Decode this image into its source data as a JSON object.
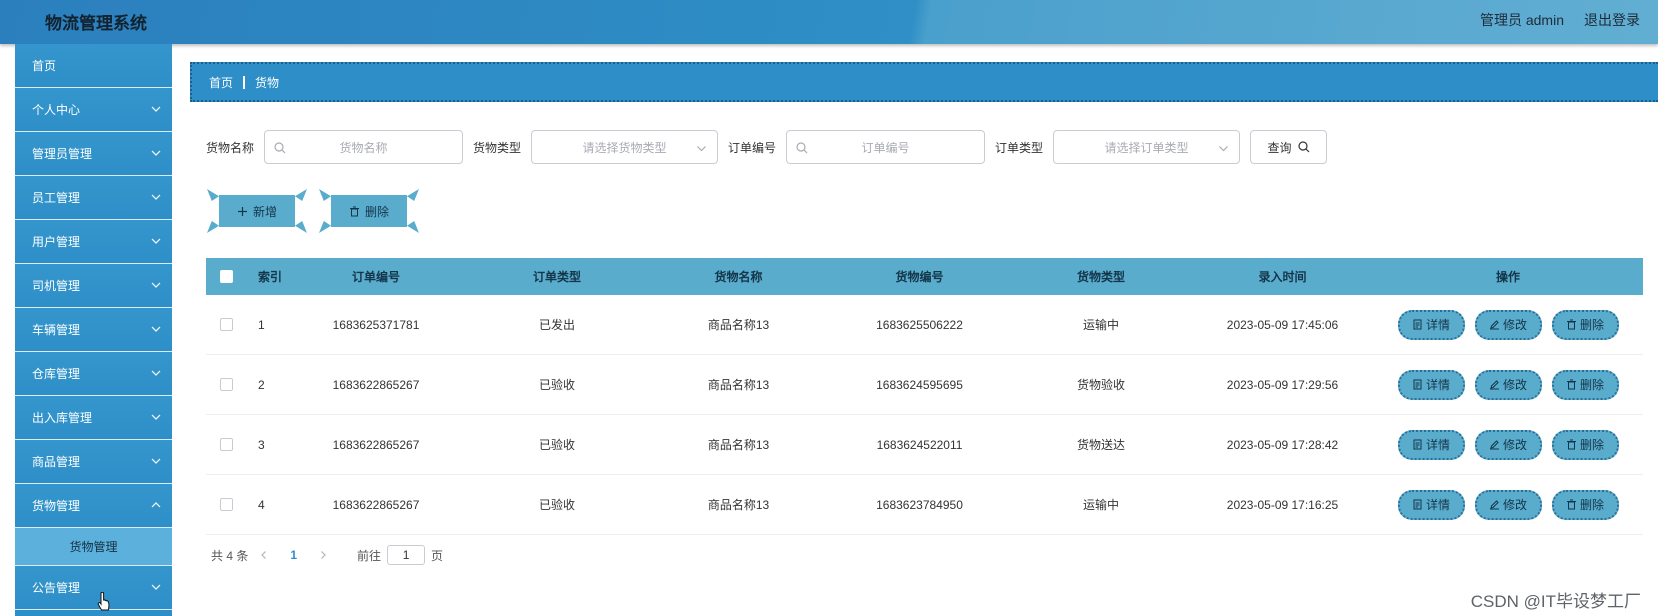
{
  "header": {
    "title": "物流管理系统",
    "user_label": "管理员 admin",
    "logout_label": "退出登录"
  },
  "sidebar": {
    "items": [
      {
        "label": "首页",
        "has_children": false
      },
      {
        "label": "个人中心",
        "has_children": true
      },
      {
        "label": "管理员管理",
        "has_children": true
      },
      {
        "label": "员工管理",
        "has_children": true
      },
      {
        "label": "用户管理",
        "has_children": true
      },
      {
        "label": "司机管理",
        "has_children": true
      },
      {
        "label": "车辆管理",
        "has_children": true
      },
      {
        "label": "仓库管理",
        "has_children": true
      },
      {
        "label": "出入库管理",
        "has_children": true
      },
      {
        "label": "商品管理",
        "has_children": true
      },
      {
        "label": "货物管理",
        "has_children": true,
        "expanded": true
      },
      {
        "label": "货物管理",
        "sub": true
      },
      {
        "label": "公告管理",
        "has_children": true
      }
    ]
  },
  "breadcrumb": {
    "home": "首页",
    "current": "货物"
  },
  "filters": {
    "goods_name_label": "货物名称",
    "goods_name_placeholder": "货物名称",
    "goods_type_label": "货物类型",
    "goods_type_placeholder": "请选择货物类型",
    "order_no_label": "订单编号",
    "order_no_placeholder": "订单编号",
    "order_type_label": "订单类型",
    "order_type_placeholder": "请选择订单类型",
    "query_label": "查询"
  },
  "actions": {
    "add_label": "新增",
    "delete_label": "删除"
  },
  "table": {
    "headers": [
      "索引",
      "订单编号",
      "订单类型",
      "货物名称",
      "货物编号",
      "货物类型",
      "录入时间",
      "操作"
    ],
    "rows": [
      {
        "index": "1",
        "order_no": "1683625371781",
        "order_type": "已发出",
        "goods_name": "商品名称13",
        "goods_no": "1683625506222",
        "goods_type": "运输中",
        "time": "2023-05-09 17:45:06"
      },
      {
        "index": "2",
        "order_no": "1683622865267",
        "order_type": "已验收",
        "goods_name": "商品名称13",
        "goods_no": "1683624595695",
        "goods_type": "货物验收",
        "time": "2023-05-09 17:29:56"
      },
      {
        "index": "3",
        "order_no": "1683622865267",
        "order_type": "已验收",
        "goods_name": "商品名称13",
        "goods_no": "1683624522011",
        "goods_type": "货物送达",
        "time": "2023-05-09 17:28:42"
      },
      {
        "index": "4",
        "order_no": "1683622865267",
        "order_type": "已验收",
        "goods_name": "商品名称13",
        "goods_no": "1683623784950",
        "goods_type": "运输中",
        "time": "2023-05-09 17:16:25"
      }
    ],
    "op_labels": {
      "detail": "详情",
      "edit": "修改",
      "delete": "删除"
    }
  },
  "pagination": {
    "total_text": "共 4 条",
    "current_page": "1",
    "goto_label": "前往",
    "goto_value": "1",
    "page_suffix": "页"
  },
  "watermark": "CSDN @IT毕设梦工厂",
  "colors": {
    "primary": "#2e8fc8",
    "accent": "#5aaccc",
    "sub_item": "#5cb1dc"
  }
}
